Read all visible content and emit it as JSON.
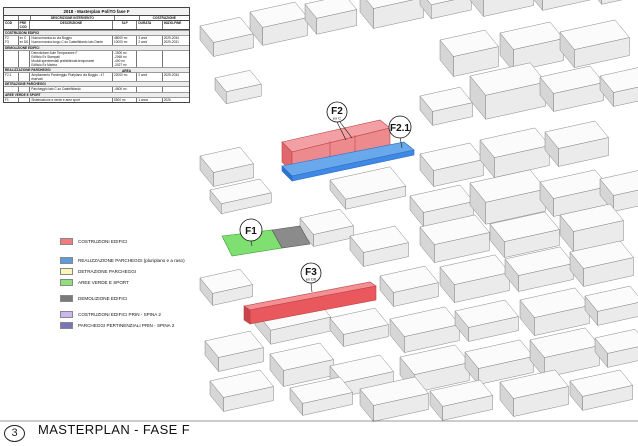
{
  "table": {
    "title": "2018 - Masterplan PoliTO fase F",
    "header": {
      "cod": "COD",
      "pre": "PRE COD",
      "desc_group": "DESCRIZIONE INTERVENTO",
      "desc": "DESCRIZIONE",
      "slp": "SLP",
      "costr_group": "COSTRUZIONE",
      "durata": "DURATA",
      "inizio": "INIZIO-FINE"
    },
    "sections": [
      {
        "title": "COSTRUZIONI EDIFICI",
        "rows": [
          {
            "cod": "F2",
            "pre": "ex C",
            "desc": "Nuova manica su via Boggio",
            "slp": "48000 m²",
            "durata": "3 anni",
            "inizio": "2029-2034"
          },
          {
            "cod": "F3",
            "pre": "ex D6",
            "desc": "Nuova manica lungo C.so Castelfidardo lato Dante",
            "slp": "10000 m²",
            "durata": "2 anni",
            "inizio": "2029-2031"
          }
        ]
      },
      {
        "title": "DEMOLIZIONE EDIFICI",
        "rows": [
          {
            "cod": "",
            "pre": "",
            "desc": "Demolizione Aule Temporanee F",
            "slp": "-1500 m²",
            "durata": "",
            "inizio": ""
          },
          {
            "cod": "",
            "pre": "",
            "desc": "Edificio Ex Stampati",
            "slp": "-2065 m²",
            "durata": "",
            "inizio": ""
          },
          {
            "cod": "",
            "pre": "",
            "desc": "Moduli sperimentali prefabbricati temporanei",
            "slp": "-400 m²",
            "durata": "",
            "inizio": ""
          },
          {
            "cod": "",
            "pre": "",
            "desc": "Edificio Ex Marina",
            "slp": "-2027 m²",
            "durata": "",
            "inizio": ""
          }
        ]
      },
      {
        "title": "REALIZZAZIONE PARCHEGGI",
        "note": "AREA",
        "rows": [
          {
            "cod": "F2.1",
            "pre": "",
            "desc": "Ampliamento Parcheggio Pluriplano via Boggio - 47 riservati",
            "slp": "22000 m²",
            "durata": "2 anni",
            "inizio": "2029-2034"
          }
        ]
      },
      {
        "title": "DETRAZIONE PARCHEGGI",
        "rows": [
          {
            "cod": "",
            "pre": "",
            "desc": "Parcheggio lato C.so Castelfidardo",
            "slp": "-4600 m²",
            "durata": "",
            "inizio": ""
          }
        ]
      },
      {
        "title": "AREE VERDE E SPORT",
        "rows": [
          {
            "cod": "F1",
            "pre": "",
            "desc": "Sistemazione a verde e aree sport",
            "slp": "6500 m²",
            "durata": "1 anno",
            "inizio": "2026"
          }
        ]
      }
    ]
  },
  "legend": [
    {
      "label": "COSTRUZIONI EDIFICI",
      "color": "#f27b7b"
    },
    {
      "label": "REALIZZAZIONE PARCHEGGI (pluriplano e a raso)",
      "color": "#5b9be0"
    },
    {
      "label": "DETRAZIONE PARCHEGGI",
      "color": "#fbf6b5"
    },
    {
      "label": "AREE VERDE E SPORT",
      "color": "#8ee07d"
    },
    {
      "label": "DEMOLIZIONE EDIFICI",
      "color": "#7a7a7a"
    },
    {
      "label": "COSTRUZIONI EDIFICI PRIN - SPINA 2",
      "color": "#cdb6f0"
    },
    {
      "label": "PARCHEGGI PERTINENZIALI PRIN - SPINA 2",
      "color": "#7a74b8"
    }
  ],
  "callouts": {
    "f1": "F1",
    "f2": "F2",
    "f2_sub": "ex C",
    "f21": "F2.1",
    "f3": "F3",
    "f3_sub": "ex D6"
  },
  "footer": {
    "page": "3",
    "title": "MASTERPLAN - FASE F"
  },
  "colors": {
    "building": "#f7f7f7",
    "outline": "#6a6a6a",
    "construction": "#e8585c",
    "parking": "#3f88e6",
    "green": "#7fe071",
    "demolition": "#7a7a7a"
  }
}
